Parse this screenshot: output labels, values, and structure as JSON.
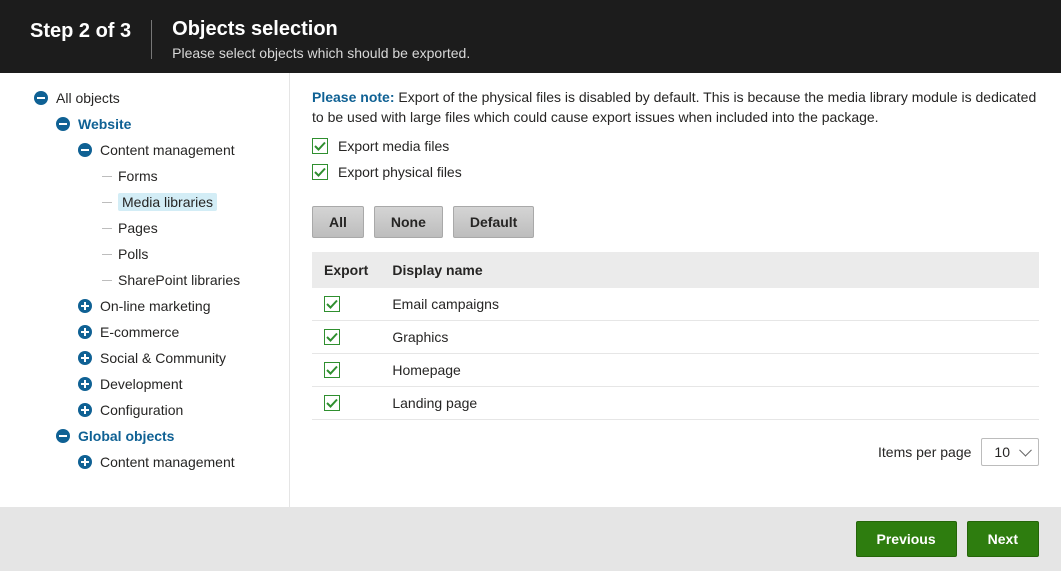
{
  "header": {
    "step": "Step 2 of 3",
    "title": "Objects selection",
    "subtitle": "Please select objects which should be exported."
  },
  "tree": {
    "root": "All objects",
    "website": "Website",
    "content_mgmt": "Content management",
    "forms": "Forms",
    "media_libraries": "Media libraries",
    "pages": "Pages",
    "polls": "Polls",
    "sharepoint": "SharePoint libraries",
    "online_marketing": "On-line marketing",
    "ecommerce": "E-commerce",
    "social": "Social & Community",
    "development": "Development",
    "configuration": "Configuration",
    "global_objects": "Global objects",
    "global_cm": "Content management"
  },
  "content": {
    "note_label": "Please note:",
    "note_text": "Export of the physical files is disabled by default. This is because the media library module is dedicated to be used with large files which could cause export issues when included into the package.",
    "chk_media": "Export media files",
    "chk_physical": "Export physical files",
    "btn_all": "All",
    "btn_none": "None",
    "btn_default": "Default",
    "col_export": "Export",
    "col_name": "Display name",
    "rows": {
      "0": "Email campaigns",
      "1": "Graphics",
      "2": "Homepage",
      "3": "Landing page"
    },
    "items_per_page_label": "Items per page",
    "items_per_page_value": "10"
  },
  "footer": {
    "previous": "Previous",
    "next": "Next"
  }
}
